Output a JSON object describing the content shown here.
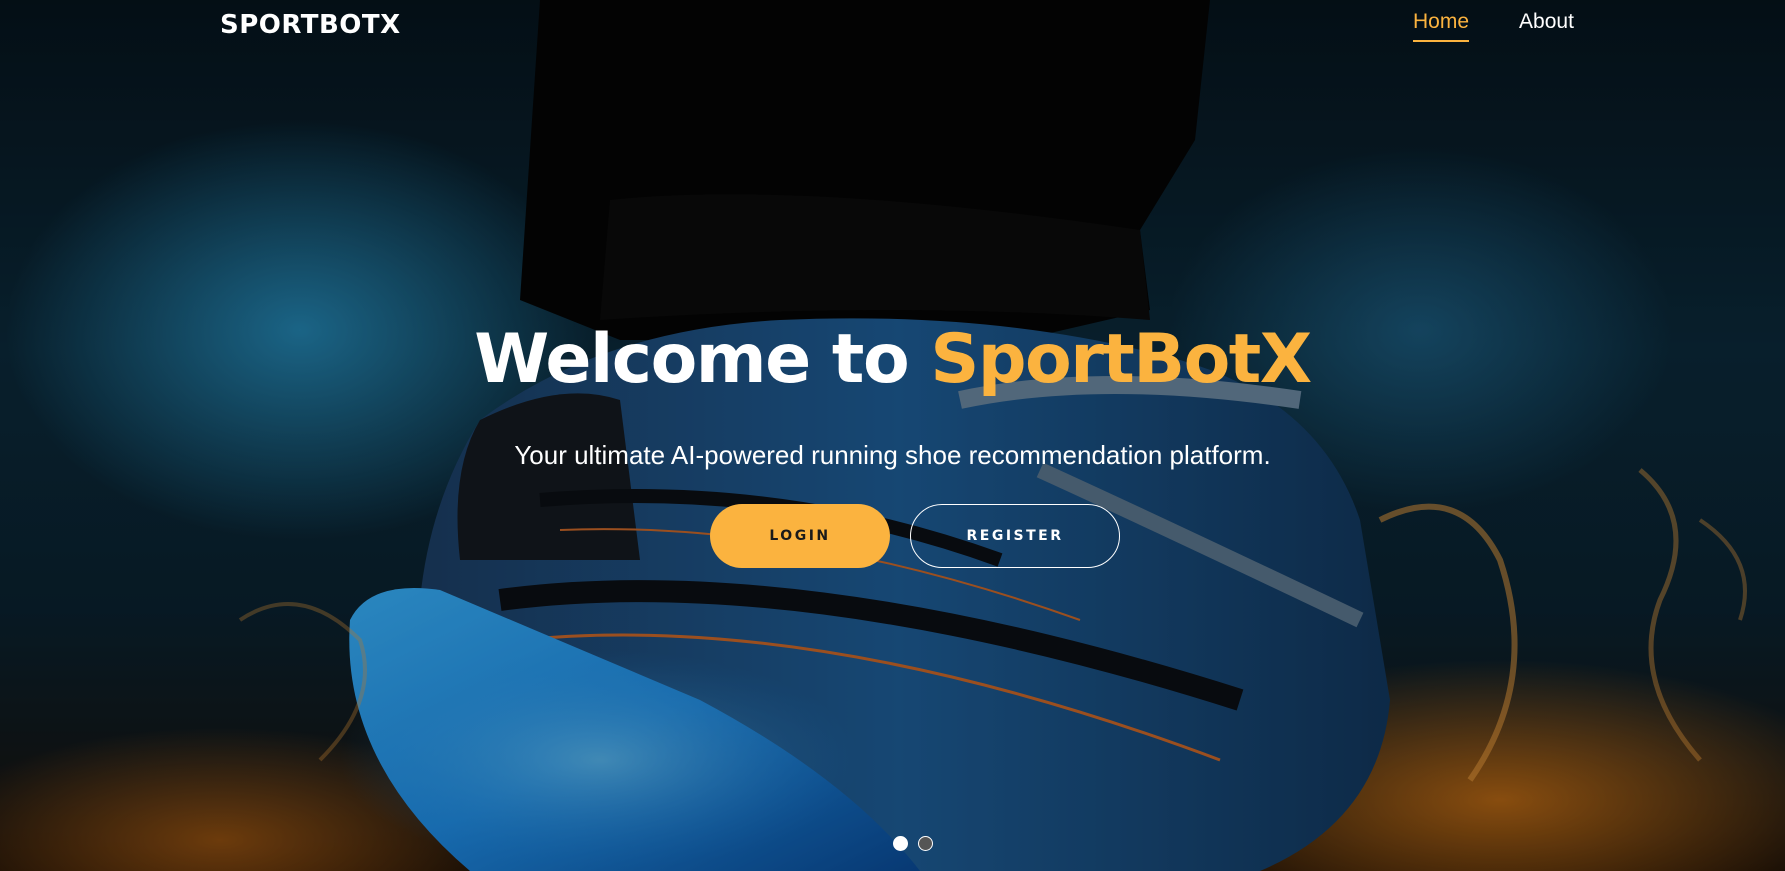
{
  "header": {
    "logo": "SPORTBOTX",
    "nav": [
      {
        "label": "Home",
        "active": true
      },
      {
        "label": "About",
        "active": false
      }
    ]
  },
  "hero": {
    "headline_prefix": "Welcome to ",
    "headline_brand": "SportBotX",
    "tagline": "Your ultimate AI-powered running shoe recommendation platform.",
    "login_label": "LOGIN",
    "register_label": "REGISTER",
    "background_image": "blue-running-shoe-with-glowing-sole",
    "carousel": {
      "slide_count": 2,
      "active_index": 0
    }
  },
  "colors": {
    "accent": "#fbb33f",
    "text": "#ffffff"
  }
}
